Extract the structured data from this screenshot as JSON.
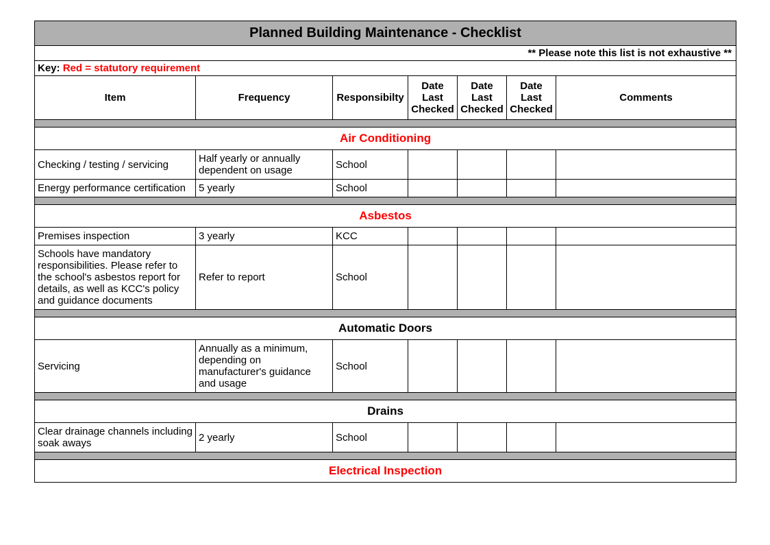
{
  "title": "Planned Building Maintenance - Checklist",
  "note": "** Please note this list is not exhaustive **",
  "key_prefix": "Key:",
  "key_red": "Red = statutory requirement",
  "headers": {
    "item": "Item",
    "frequency": "Frequency",
    "responsibility": "Responsibilty",
    "date1": "Date Last Checked",
    "date2": "Date Last Checked",
    "date3": "Date Last Checked",
    "comments": "Comments"
  },
  "sections": [
    {
      "name": "Air Conditioning",
      "statutory": true,
      "rows": [
        {
          "item": "Checking / testing / servicing",
          "frequency": "Half yearly or annually dependent on usage",
          "responsibility": "School",
          "d1": "",
          "d2": "",
          "d3": "",
          "comments": ""
        },
        {
          "item": "Energy performance certification",
          "frequency": "5 yearly",
          "responsibility": "School",
          "d1": "",
          "d2": "",
          "d3": "",
          "comments": ""
        }
      ]
    },
    {
      "name": "Asbestos",
      "statutory": true,
      "rows": [
        {
          "item": "Premises inspection",
          "frequency": "3 yearly",
          "responsibility": "KCC",
          "d1": "",
          "d2": "",
          "d3": "",
          "comments": ""
        },
        {
          "item": "Schools have mandatory responsibilities. Please refer to the school's asbestos report for details, as well as KCC's policy and guidance documents",
          "frequency": "Refer to report",
          "responsibility": "School",
          "d1": "",
          "d2": "",
          "d3": "",
          "comments": ""
        }
      ]
    },
    {
      "name": "Automatic Doors",
      "statutory": false,
      "rows": [
        {
          "item": "Servicing",
          "frequency": "Annually as a minimum, depending on manufacturer's guidance and usage",
          "responsibility": "School",
          "d1": "",
          "d2": "",
          "d3": "",
          "comments": ""
        }
      ]
    },
    {
      "name": "Drains",
      "statutory": false,
      "rows": [
        {
          "item": "Clear drainage channels including soak aways",
          "frequency": "2 yearly",
          "responsibility": "School",
          "d1": "",
          "d2": "",
          "d3": "",
          "comments": ""
        }
      ]
    },
    {
      "name": "Electrical Inspection",
      "statutory": true,
      "rows": []
    }
  ]
}
